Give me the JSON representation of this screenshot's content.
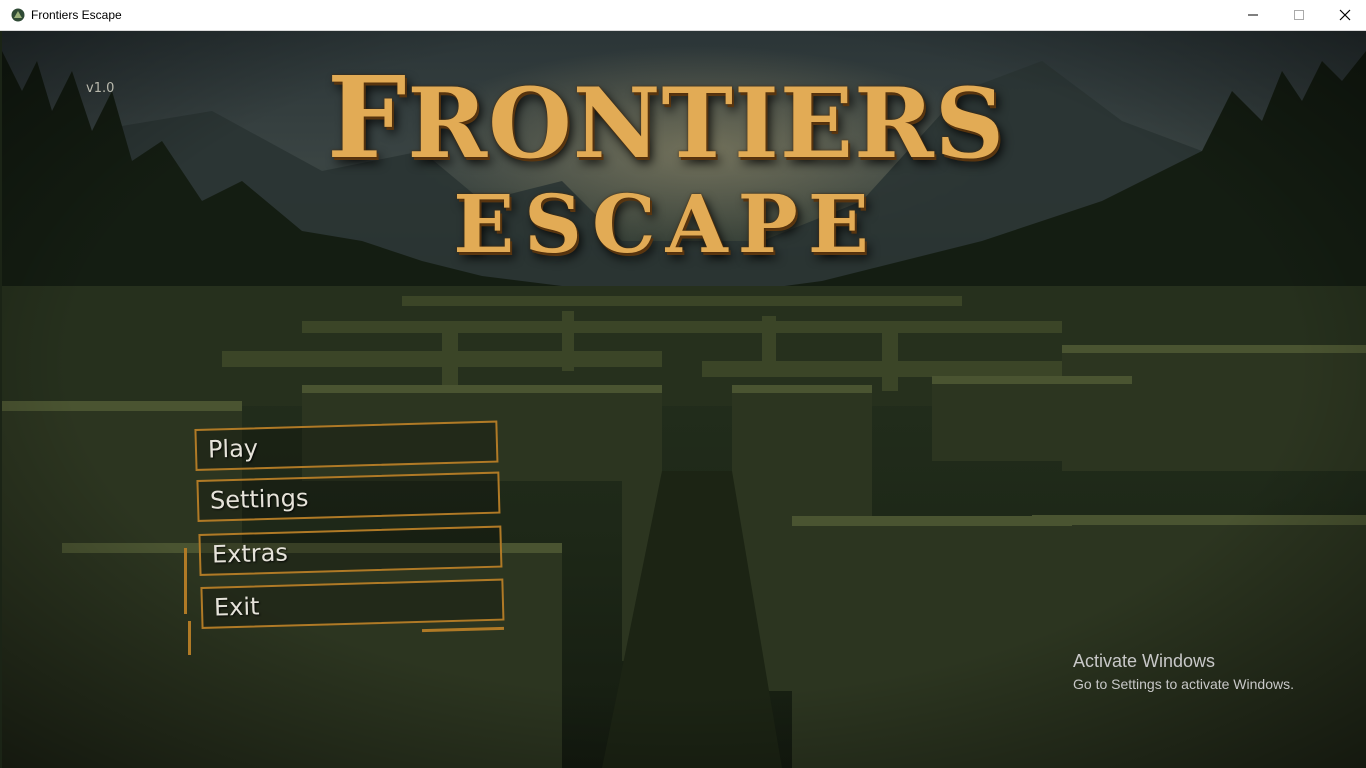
{
  "window": {
    "title": "Frontiers Escape",
    "minimize_glyph": "—",
    "maximize_glyph": "☐",
    "close_glyph": "✕"
  },
  "game": {
    "version": "v1.0",
    "title_line1_initial": "F",
    "title_line1_rest": "RONTIERS",
    "title_line2": "ESCAPE",
    "title_color": "#e2ab55",
    "accent_color": "#b07a26"
  },
  "menu": {
    "items": [
      {
        "label": "Play"
      },
      {
        "label": "Settings"
      },
      {
        "label": "Extras"
      },
      {
        "label": "Exit"
      }
    ]
  },
  "watermark": {
    "title": "Activate Windows",
    "subtitle": "Go to Settings to activate Windows."
  }
}
